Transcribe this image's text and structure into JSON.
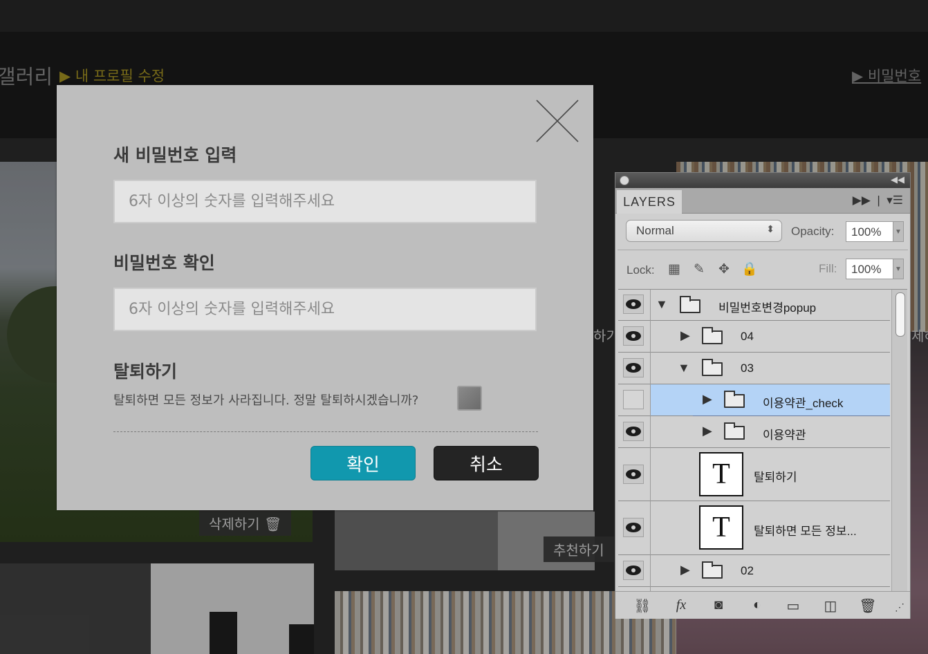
{
  "site": {
    "nav_gallery": "갤러리",
    "nav_profile": "▶ 내 프로필 수정",
    "nav_password": "▶ 비밀번호",
    "tag_delete": "삭제하기 🗑",
    "tag_recommend": "추천하기",
    "frag_a": "하기",
    "frag_b": "제하"
  },
  "modal": {
    "new_pw_title": "새 비밀번호 입력",
    "new_pw_placeholder": "6자 이상의 숫자를 입력해주세요",
    "confirm_pw_title": "비밀번호 확인",
    "confirm_pw_placeholder": "6자 이상의 숫자를 입력해주세요",
    "withdraw_title": "탈퇴하기",
    "withdraw_desc": "탈퇴하면 모든 정보가 사라집니다. 정말 탈퇴하시겠습니까?",
    "withdraw_checked": false,
    "confirm_label": "확인",
    "cancel_label": "취소",
    "colors": {
      "confirm": "#1198ae",
      "cancel": "#242424"
    }
  },
  "layers_panel": {
    "tab": "LAYERS",
    "blend_mode": "Normal",
    "opacity_label": "Opacity:",
    "opacity_value": "100%",
    "lock_label": "Lock:",
    "fill_label": "Fill:",
    "fill_value": "100%",
    "layers": [
      {
        "name": "비밀번호변경popup",
        "type": "folder",
        "expanded": true,
        "visible": true,
        "selected": false
      },
      {
        "name": "04",
        "type": "folder",
        "expanded": false,
        "visible": true,
        "selected": false
      },
      {
        "name": "03",
        "type": "folder",
        "expanded": true,
        "visible": true,
        "selected": false
      },
      {
        "name": "이용약관_check",
        "type": "folder",
        "expanded": false,
        "visible": false,
        "selected": true
      },
      {
        "name": "이용약관",
        "type": "folder",
        "expanded": false,
        "visible": true,
        "selected": false
      },
      {
        "name": "탈퇴하기",
        "type": "text",
        "visible": true,
        "selected": false
      },
      {
        "name": "탈퇴하면 모든 정보...",
        "type": "text",
        "visible": true,
        "selected": false
      },
      {
        "name": "02",
        "type": "folder",
        "expanded": false,
        "visible": true,
        "selected": false
      }
    ],
    "thumb_glyph": "T",
    "bottom_icons": [
      "link-icon",
      "fx-icon",
      "mask-icon",
      "adjustment-icon",
      "new-group-icon",
      "new-layer-icon",
      "trash-icon"
    ]
  }
}
